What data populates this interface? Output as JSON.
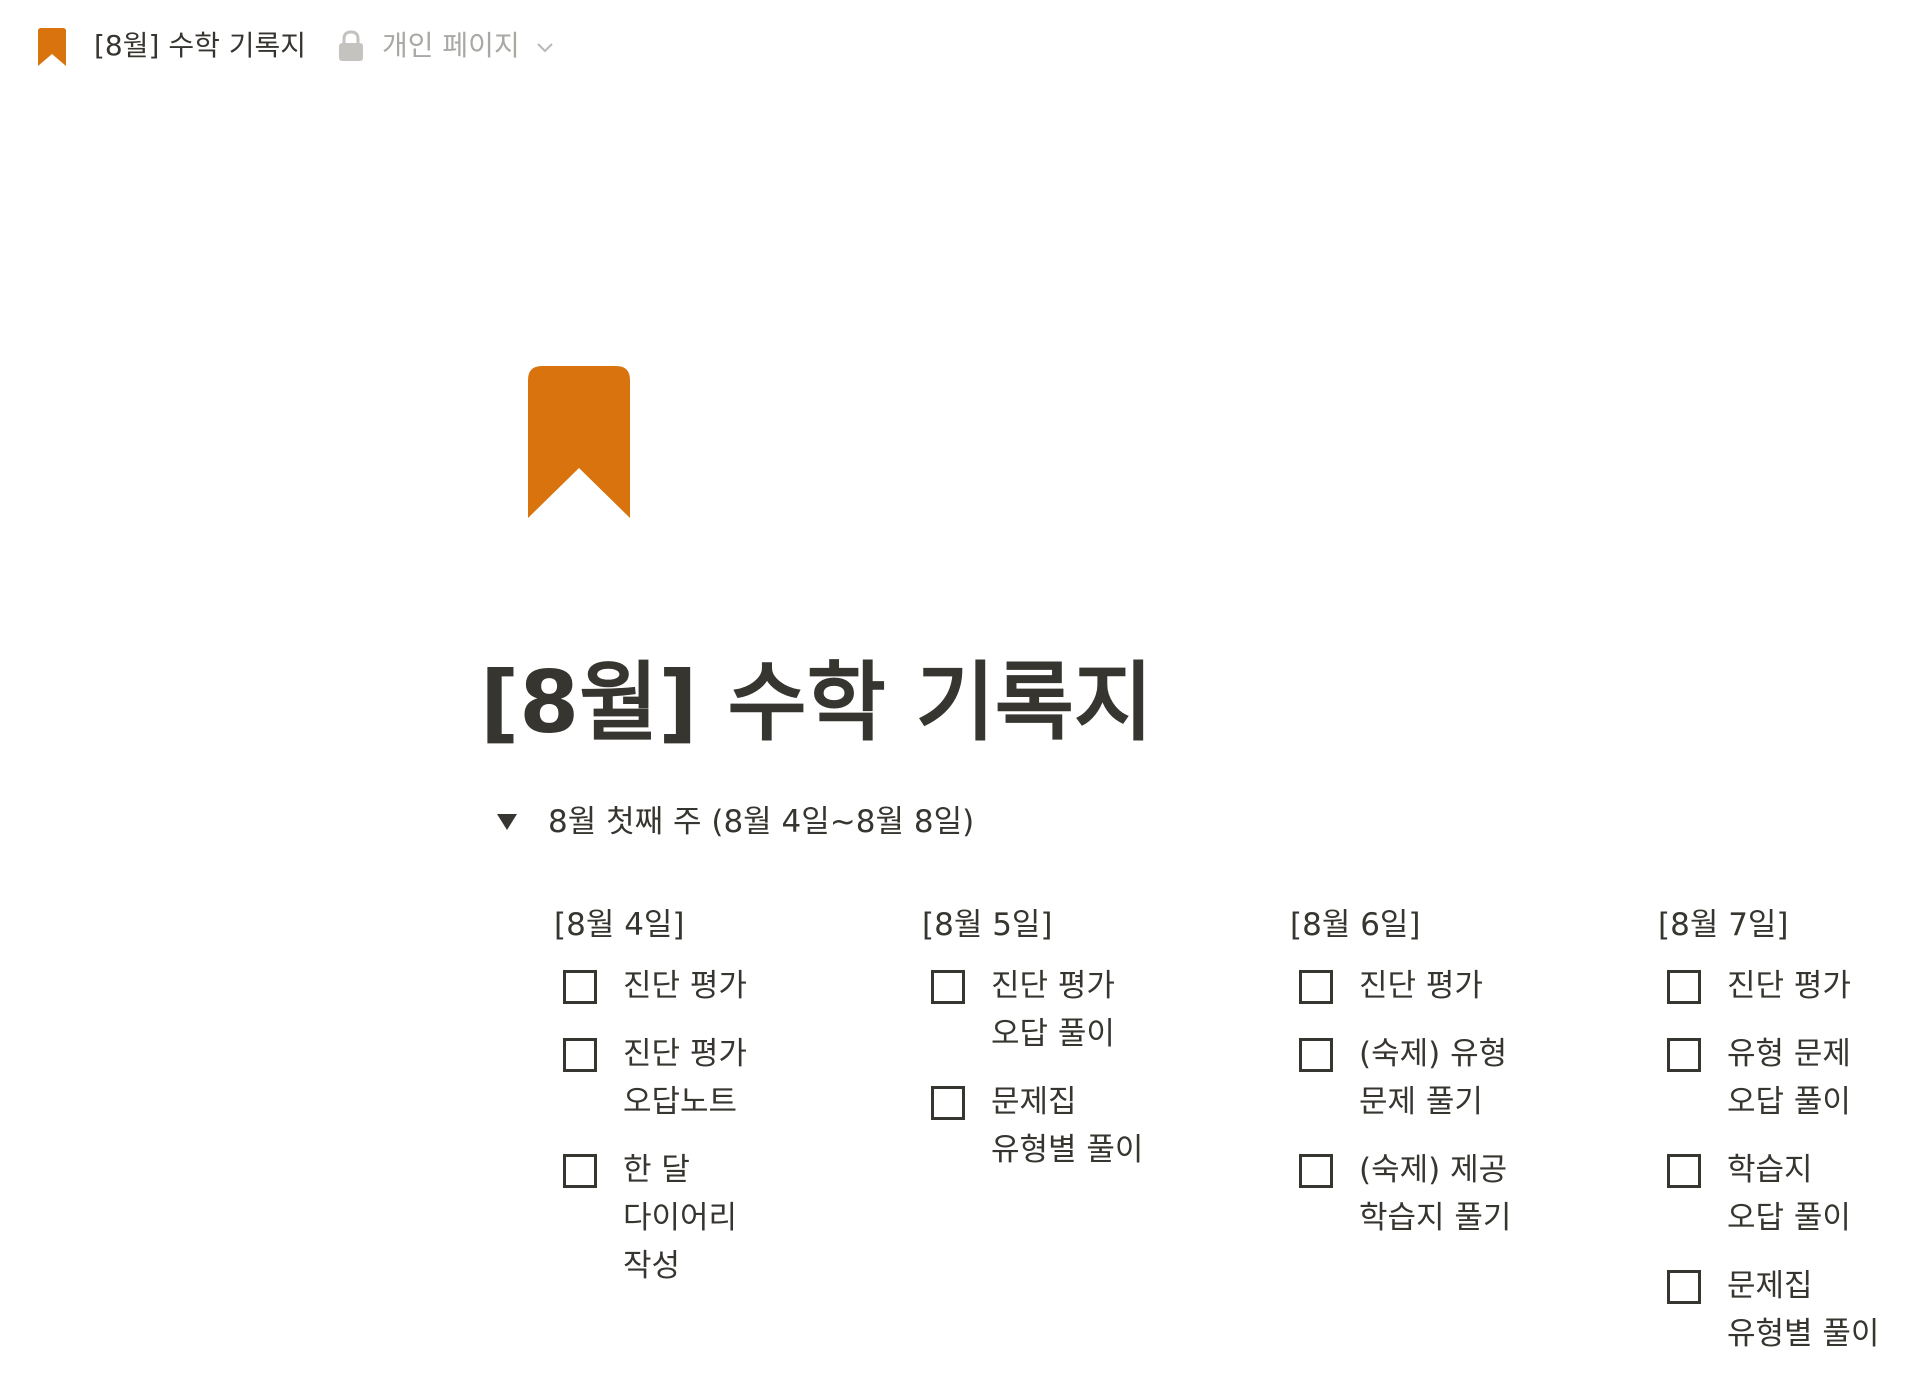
{
  "topbar": {
    "breadcrumb_title": "[8월] 수학 기록지",
    "privacy_label": "개인 페이지"
  },
  "page": {
    "icon": "bookmark-icon",
    "title": "[8월] 수학 기록지",
    "accent_color": "#d9730d"
  },
  "toggle": {
    "label": "8월 첫째 주 (8월 4일~8월 8일)",
    "expanded": true
  },
  "columns": [
    {
      "heading": "[8월 4일]",
      "todos": [
        {
          "text": "진단 평가",
          "checked": false
        },
        {
          "text": "진단 평가 오답노트",
          "checked": false
        },
        {
          "text": "한 달 다이어리 작성",
          "checked": false
        }
      ]
    },
    {
      "heading": "[8월 5일]",
      "todos": [
        {
          "text": "진단 평가 오답 풀이",
          "checked": false
        },
        {
          "text": "문제집 유형별 풀이",
          "checked": false
        }
      ]
    },
    {
      "heading": "[8월 6일]",
      "todos": [
        {
          "text": "진단 평가",
          "checked": false
        },
        {
          "text": "(숙제) 유형 문제 풀기",
          "checked": false
        },
        {
          "text": "(숙제) 제공 학습지 풀기",
          "checked": false
        }
      ]
    },
    {
      "heading": "[8월 7일]",
      "todos": [
        {
          "text": "진단 평가",
          "checked": false
        },
        {
          "text": "유형 문제 오답 풀이",
          "checked": false
        },
        {
          "text": "학습지 오답 풀이",
          "checked": false
        },
        {
          "text": "문제집 유형별 풀이",
          "checked": false
        }
      ]
    }
  ]
}
